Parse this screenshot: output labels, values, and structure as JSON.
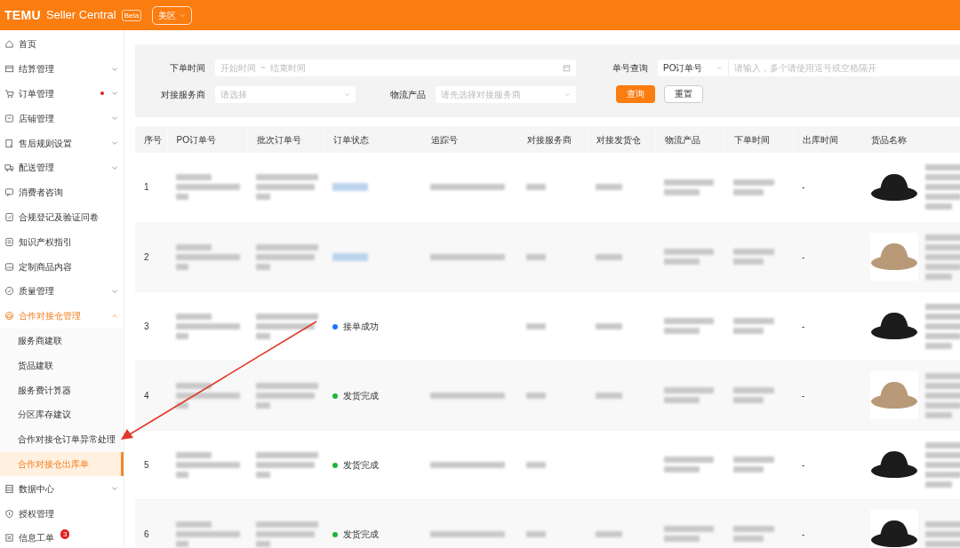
{
  "header": {
    "logo": "TEMU",
    "title": "Seller Central",
    "badge": "Beta",
    "region": "美区"
  },
  "sidebar": {
    "items": [
      {
        "label": "首页",
        "selected": false
      },
      {
        "label": "结算管理",
        "selected": false,
        "expanded": false
      },
      {
        "label": "订单管理",
        "selected": false,
        "expanded": false,
        "dot": true
      },
      {
        "label": "店铺管理",
        "selected": false,
        "expanded": false
      },
      {
        "label": "售后规则设置",
        "selected": false,
        "expanded": false
      },
      {
        "label": "配送管理",
        "selected": false,
        "expanded": false
      },
      {
        "label": "消费者咨询",
        "selected": false
      },
      {
        "label": "合规登记及验证问卷",
        "selected": false
      },
      {
        "label": "知识产权指引",
        "selected": false
      },
      {
        "label": "定制商品内容",
        "selected": false
      },
      {
        "label": "质量管理",
        "selected": false,
        "expanded": false
      },
      {
        "label": "合作对接仓管理",
        "selected": false,
        "expanded": true,
        "children": [
          {
            "label": "服务商建联",
            "selected": false
          },
          {
            "label": "货品建联",
            "selected": false
          },
          {
            "label": "服务费计算器",
            "selected": false
          },
          {
            "label": "分区库存建议",
            "selected": false
          },
          {
            "label": "合作对接仓订单异常处理",
            "selected": false
          },
          {
            "label": "合作对接仓出库单",
            "selected": true
          }
        ]
      },
      {
        "label": "数据中心",
        "selected": false,
        "expanded": false
      },
      {
        "label": "授权管理",
        "selected": false
      },
      {
        "label": "信息工单",
        "selected": false,
        "badge": "3"
      }
    ]
  },
  "filters": {
    "order_time": {
      "label": "下单时间",
      "start_placeholder": "开始时间",
      "separator": "~",
      "end_placeholder": "结束时间"
    },
    "order_search": {
      "label": "单号查询",
      "type": "PO订单号",
      "placeholder": "请输入，多个请使用逗号或空格隔开"
    },
    "provider": {
      "label": "对接服务商",
      "placeholder": "请选择"
    },
    "logistics": {
      "label": "物流产品",
      "placeholder": "请先选择对接服务商"
    },
    "buttons": [
      {
        "label": "查询",
        "kind": "primary"
      },
      {
        "label": "重置",
        "kind": "default"
      }
    ]
  },
  "table": {
    "columns": [
      "序号",
      "PO订单号",
      "批次订单号",
      "订单状态",
      "追踪号",
      "对接服务商",
      "对接发货仓",
      "物流产品",
      "下单时间",
      "出库时间",
      "货品名称"
    ],
    "rows": [
      {
        "number": "1",
        "ship_time": "-"
      },
      {
        "number": "2",
        "ship_time": "-"
      },
      {
        "number": "3",
        "status": {
          "label": "接单成功",
          "color": "#1677ff"
        },
        "ship_time": "-"
      },
      {
        "number": "4",
        "status": {
          "label": "发货完成",
          "color": "#22b33a"
        },
        "ship_time": "-"
      },
      {
        "number": "5",
        "status": {
          "label": "发货完成",
          "color": "#22b33a"
        },
        "ship_time": "-"
      },
      {
        "number": "6",
        "status": {
          "label": "发货完成",
          "color": "#22b33a"
        },
        "ship_time": "-"
      }
    ]
  }
}
